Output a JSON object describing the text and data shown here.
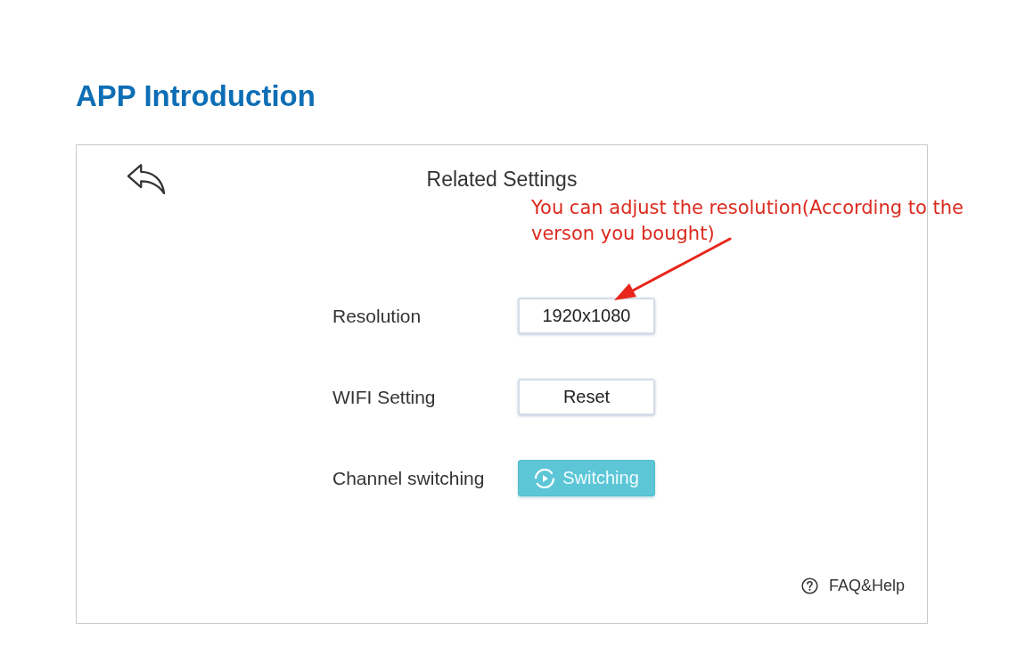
{
  "page_title": "APP Introduction",
  "screen": {
    "title": "Related Settings",
    "settings": [
      {
        "label": "Resolution",
        "kind": "button",
        "value": "1920x1080"
      },
      {
        "label": "WIFI Setting",
        "kind": "button",
        "value": "Reset"
      },
      {
        "label": "Channel switching",
        "kind": "primary",
        "value": "Switching"
      }
    ],
    "help": "FAQ&Help"
  },
  "annotation": "You can adjust the resolution(According to the verson you bought)"
}
